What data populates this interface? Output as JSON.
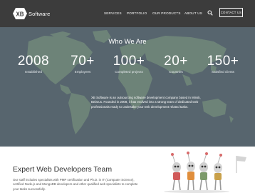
{
  "brand": {
    "mark": "XB",
    "name": "Software"
  },
  "nav": {
    "items": [
      "SERVICES",
      "PORTFOLIO",
      "OUR PRODUCTS",
      "ABOUT US"
    ],
    "search_icon": "search-icon",
    "contact_label": "CONTACT US"
  },
  "hero": {
    "title": "Who We Are",
    "stats": [
      {
        "value": "2008",
        "label": "Established"
      },
      {
        "value": "70+",
        "label": "Employees"
      },
      {
        "value": "100+",
        "label": "Completed projects"
      },
      {
        "value": "20+",
        "label": "Countries"
      },
      {
        "value": "150+",
        "label": "Satisfied clients"
      }
    ],
    "description": "XB Software is an outsourcing software development company based in Minsk, Belarus. Founded in 2008, it has evolved into a strong team of dedicated web professionals ready to undertake your web development related tasks."
  },
  "team": {
    "title": "Expert Web Developers Team",
    "description": "Our staff includes specialists with PMP certification and Ph.D. in IT (Computer Science), certified Node.js and MongoDB developers and other qualified web specialists to complete your tasks successfully."
  },
  "colors": {
    "header_bg": "#3c3c3c",
    "hero_overlay": "#5d6a72",
    "map_land": "#8aa48c",
    "accent": "#c0392b"
  }
}
